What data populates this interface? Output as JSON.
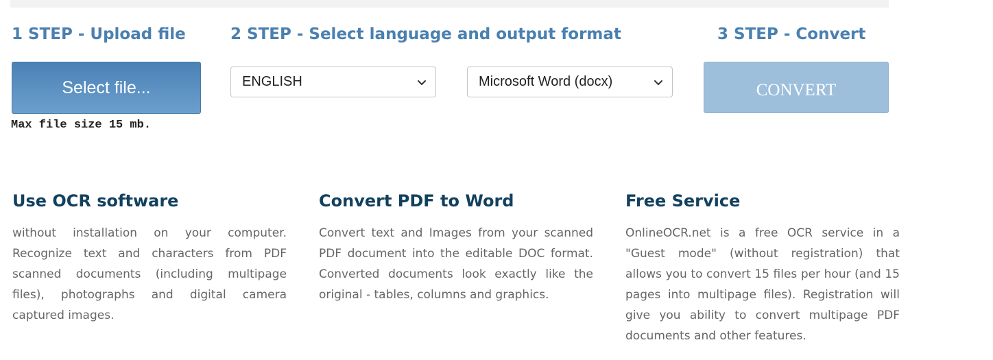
{
  "steps": {
    "step1_title": "1 STEP - Upload file",
    "step2_title": "2 STEP - Select language and output format",
    "step3_title": "3 STEP - Convert"
  },
  "upload": {
    "select_file_label": "Select file...",
    "max_size_note": "Max file size 15 mb."
  },
  "options": {
    "language_selected": "ENGLISH",
    "format_selected": "Microsoft Word (docx)"
  },
  "convert": {
    "label": "CONVERT"
  },
  "features": [
    {
      "title": "Use OCR software",
      "text": "without installation on your computer. Recognize text and characters from PDF scanned documents (including multipage files), photographs and digital camera captured images."
    },
    {
      "title": "Convert PDF to Word",
      "text": "Convert text and Images from your scanned PDF document into the editable DOC format. Converted documents look exactly like the original - tables, columns and graphics."
    },
    {
      "title": "Free Service",
      "text": "OnlineOCR.net is a free OCR service in a \"Guest mode\" (without registration) that allows you to convert 15 files per hour (and 15 pages into multipage files). Registration will give you ability to convert multipage PDF documents and other features."
    }
  ],
  "colors": {
    "step_title": "#4a80b0",
    "feature_title": "#12405e",
    "select_button": "#4a82b6",
    "convert_button_disabled": "#9dbfdc",
    "body_text": "#666666"
  },
  "icons": {
    "dropdown_arrow": "chevron-down-icon"
  }
}
